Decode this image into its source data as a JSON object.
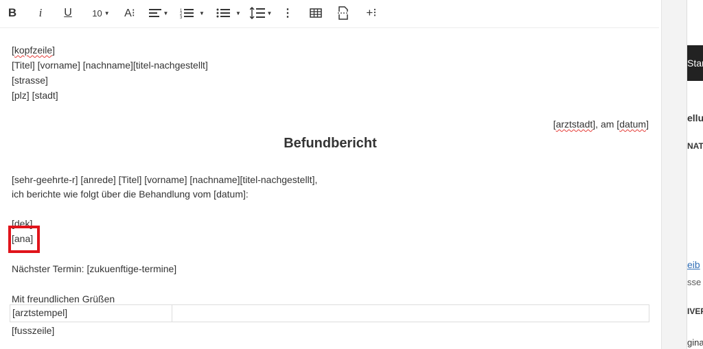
{
  "toolbar": {
    "bold": "B",
    "italic": "i",
    "underline": "U",
    "font_size": "10",
    "font_size_icon": "A⁝",
    "more": "⋮",
    "insert": "+⁝"
  },
  "doc": {
    "header_lines": [
      {
        "parts": [
          "[",
          "kopfzeile",
          "]"
        ]
      },
      {
        "text": "[Titel] [vorname] [nachname][titel-nachgestellt]"
      },
      {
        "text": "[strasse]"
      },
      {
        "text": "[plz] [stadt]"
      }
    ],
    "place_date": {
      "city": "arztstadt",
      "mid": "], am [",
      "date": "datum"
    },
    "title": "Befundbericht",
    "salutation": "[sehr-geehrte-r] [anrede] [Titel] [vorname] [nachname][titel-nachgestellt],",
    "intro": "ich berichte wie folgt über die Behandlung vom [datum]:",
    "dek": "[dek]",
    "ana": "[ana]",
    "next_label": "Nächster Termin: ",
    "next_value": "[zukuenftige-termine]",
    "closing": "Mit freundlichen Grüßen",
    "stamp": "[arztstempel]",
    "footer": "[fusszeile]"
  },
  "sidebar": {
    "tab": "Star",
    "t1": "ellur",
    "t2": "NAT",
    "link": "eib",
    "t3": "sse",
    "t4": "IVEF",
    "t5": "gina"
  }
}
